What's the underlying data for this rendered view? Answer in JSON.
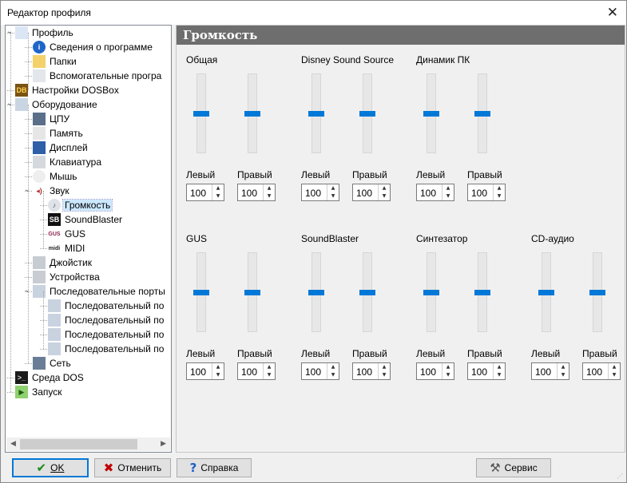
{
  "window": {
    "title": "Редактор профиля",
    "close_glyph": "✕"
  },
  "tree": {
    "items": [
      {
        "label": "Профиль",
        "icon": "profile-icon",
        "level": 0,
        "expander": "−"
      },
      {
        "label": "Сведения о программе",
        "icon": "info-icon",
        "level": 1
      },
      {
        "label": "Папки",
        "icon": "folder-icon",
        "level": 1
      },
      {
        "label": "Вспомогательные програ",
        "icon": "app-icon",
        "level": 1
      },
      {
        "label": "Настройки DOSBox",
        "icon": "dosbox-icon",
        "level": 0
      },
      {
        "label": "Оборудование",
        "icon": "hardware-icon",
        "level": 0,
        "expander": "−"
      },
      {
        "label": "ЦПУ",
        "icon": "cpu-icon",
        "level": 1
      },
      {
        "label": "Память",
        "icon": "memory-icon",
        "level": 1
      },
      {
        "label": "Дисплей",
        "icon": "monitor-icon",
        "level": 1
      },
      {
        "label": "Клавиатура",
        "icon": "keyboard-icon",
        "level": 1
      },
      {
        "label": "Мышь",
        "icon": "mouse-icon",
        "level": 1
      },
      {
        "label": "Звук",
        "icon": "sound-icon",
        "level": 1,
        "expander": "−"
      },
      {
        "label": "Громкость",
        "icon": "volume-icon",
        "level": 2,
        "selected": true
      },
      {
        "label": "SoundBlaster",
        "icon": "soundblaster-icon",
        "level": 2
      },
      {
        "label": "GUS",
        "icon": "gus-icon",
        "level": 2
      },
      {
        "label": "MIDI",
        "icon": "midi-icon",
        "level": 2
      },
      {
        "label": "Джойстик",
        "icon": "joystick-icon",
        "level": 1
      },
      {
        "label": "Устройства",
        "icon": "devices-icon",
        "level": 1
      },
      {
        "label": "Последовательные порты",
        "icon": "serial-ports-icon",
        "level": 1,
        "expander": "−"
      },
      {
        "label": "Последовательный по",
        "icon": "serial-port-icon",
        "level": 2
      },
      {
        "label": "Последовательный по",
        "icon": "serial-port-icon",
        "level": 2
      },
      {
        "label": "Последовательный по",
        "icon": "serial-port-icon",
        "level": 2
      },
      {
        "label": "Последовательный по",
        "icon": "serial-port-icon",
        "level": 2
      },
      {
        "label": "Сеть",
        "icon": "network-icon",
        "level": 1
      },
      {
        "label": "Среда DOS",
        "icon": "dos-icon",
        "level": 0
      },
      {
        "label": "Запуск",
        "icon": "run-icon",
        "level": 0
      }
    ]
  },
  "panel": {
    "header": "Громкость",
    "left_label": "Левый",
    "right_label": "Правый",
    "groups": [
      {
        "title": "Общая",
        "left": "100",
        "right": "100"
      },
      {
        "title": "Disney Sound Source",
        "left": "100",
        "right": "100"
      },
      {
        "title": "Динамик ПК",
        "left": "100",
        "right": "100"
      },
      {
        "title": "GUS",
        "left": "100",
        "right": "100"
      },
      {
        "title": "SoundBlaster",
        "left": "100",
        "right": "100"
      },
      {
        "title": "Синтезатор",
        "left": "100",
        "right": "100"
      },
      {
        "title": "CD-аудио",
        "left": "100",
        "right": "100"
      }
    ],
    "slider_level_percent": 50
  },
  "buttons": {
    "ok": {
      "label": "OK",
      "icon": "check-icon"
    },
    "cancel": {
      "label": "Отменить",
      "icon": "x-icon"
    },
    "help": {
      "label": "Справка",
      "icon": "question-icon"
    },
    "service": {
      "label": "Сервис",
      "icon": "tools-icon"
    }
  }
}
